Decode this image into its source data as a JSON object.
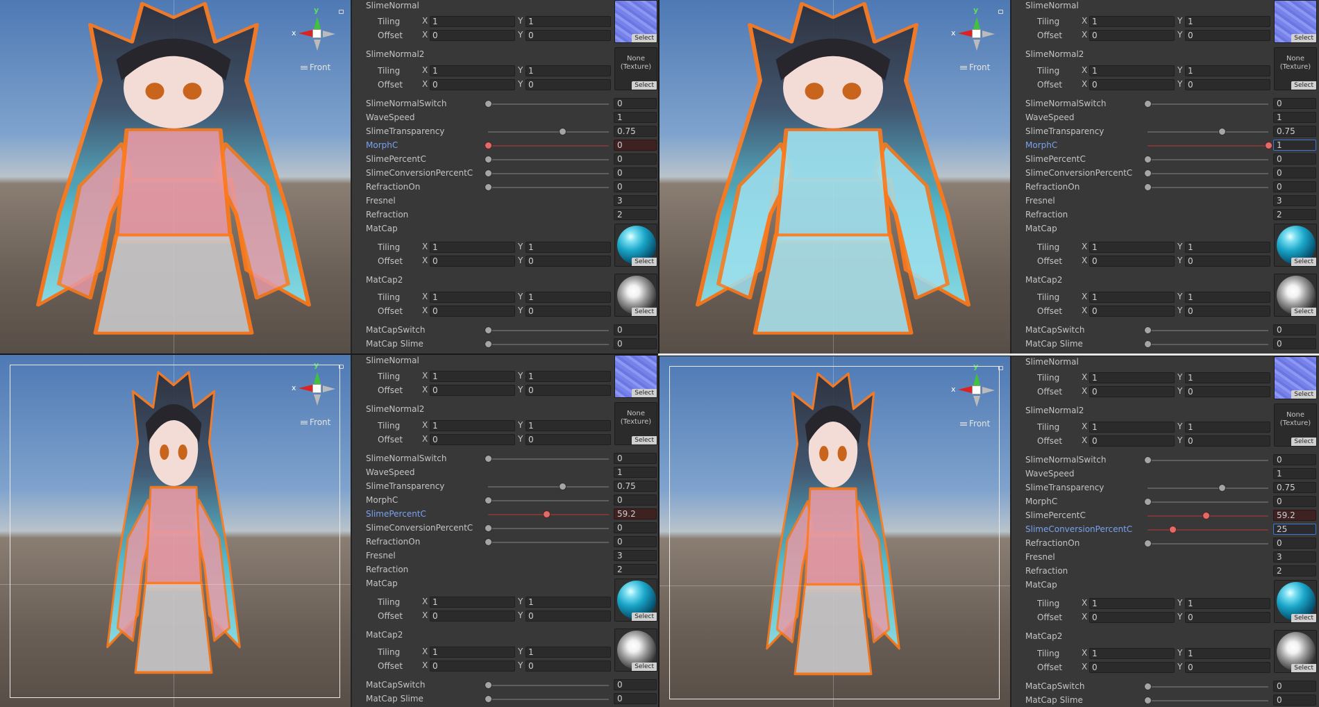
{
  "colors": {
    "accent_blue": "#7aa2f0",
    "slider_red": "#e06b6b",
    "outline_orange": "#ff7a1a",
    "inspector_bg": "#383838"
  },
  "viewport": {
    "front_label": "Front",
    "gizmo_x": "x",
    "gizmo_y": "y",
    "menu_icon": "hamburger-icon"
  },
  "labels": {
    "slime_normal": "SlimeNormal",
    "slime_normal2": "SlimeNormal2",
    "tiling": "Tiling",
    "offset": "Offset",
    "x": "X",
    "y": "Y",
    "select": "Select",
    "none_texture_1": "None",
    "none_texture_2": "(Texture)",
    "slime_normal_switch": "SlimeNormalSwitch",
    "wave_speed": "WaveSpeed",
    "slime_transparency": "SlimeTransparency",
    "morph_c": "MorphC",
    "slime_percent_c": "SlimePercentC",
    "slime_conversion_percent_c": "SlimeConversionPercentC",
    "refraction_on": "RefractionOn",
    "fresnel": "Fresnel",
    "refraction": "Refraction",
    "matcap": "MatCap",
    "matcap2": "MatCap2",
    "matcap_switch": "MatCapSwitch",
    "matcap_slime": "MatCap Slime"
  },
  "panels": [
    {
      "tiling_x": "1",
      "tiling_y": "1",
      "offset_x": "0",
      "offset_y": "0",
      "slime_normal_switch": "0",
      "wave_speed": "1",
      "slime_transparency": "0.75",
      "morph_c": "0",
      "slime_percent_c": "0",
      "slime_conversion_percent_c": "0",
      "refraction_on": "0",
      "fresnel": "3",
      "refraction": "2",
      "matcap_switch": "0",
      "matcap_slime": "0"
    },
    {
      "tiling_x": "1",
      "tiling_y": "1",
      "offset_x": "0",
      "offset_y": "0",
      "slime_normal_switch": "0",
      "wave_speed": "1",
      "slime_transparency": "0.75",
      "morph_c": "1",
      "slime_percent_c": "0",
      "slime_conversion_percent_c": "0",
      "refraction_on": "0",
      "fresnel": "3",
      "refraction": "2",
      "matcap_switch": "0",
      "matcap_slime": "0"
    },
    {
      "tiling_x": "1",
      "tiling_y": "1",
      "offset_x": "0",
      "offset_y": "0",
      "slime_normal_switch": "0",
      "wave_speed": "1",
      "slime_transparency": "0.75",
      "morph_c": "0",
      "slime_percent_c": "59.2",
      "slime_conversion_percent_c": "0",
      "refraction_on": "0",
      "fresnel": "3",
      "refraction": "2",
      "matcap_switch": "0",
      "matcap_slime": "0"
    },
    {
      "tiling_x": "1",
      "tiling_y": "1",
      "offset_x": "0",
      "offset_y": "0",
      "slime_normal_switch": "0",
      "wave_speed": "1",
      "slime_transparency": "0.75",
      "morph_c": "0",
      "slime_percent_c": "59.2",
      "slime_conversion_percent_c": "25",
      "refraction_on": "0",
      "fresnel": "3",
      "refraction": "2",
      "matcap_switch": "0",
      "matcap_slime": "0"
    }
  ]
}
